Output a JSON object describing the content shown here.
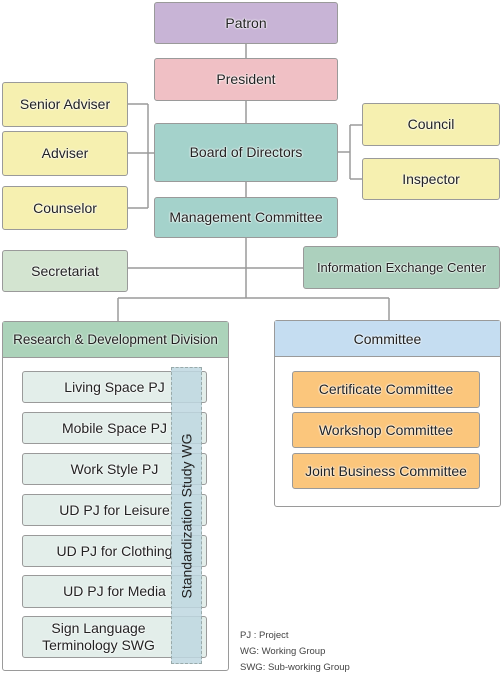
{
  "top": {
    "patron": "Patron",
    "president": "President",
    "board": "Board of Directors",
    "management": "Management Committee"
  },
  "left": [
    "Senior Adviser",
    "Adviser",
    "Counselor"
  ],
  "right": [
    "Council",
    "Inspector"
  ],
  "secretariat": "Secretariat",
  "info_center": "Information Exchange Center",
  "rd": {
    "title": "Research & Development Division",
    "items": [
      "Living Space PJ",
      "Mobile Space PJ",
      "Work Style PJ",
      "UD PJ for Leisure",
      "UD PJ for Clothing",
      "UD PJ for Media",
      "Sign Language Terminology SWG"
    ],
    "wg": "Standardization Study WG"
  },
  "committee": {
    "title": "Committee",
    "items": [
      "Certificate Committee",
      "Workshop Committee",
      "Joint Business Committee"
    ]
  },
  "legend": [
    "PJ : Project",
    "WG: Working Group",
    "SWG: Sub-working Group"
  ],
  "colors": {
    "patron": "#c8b4d6",
    "president": "#f0c0c5",
    "board": "#a4d2cb",
    "adviser": "#f6f0b0",
    "secretariat": "#d3e4d0",
    "info_center": "#acd0bd",
    "rd_header": "#acd3ba",
    "committee_header": "#c5ddf1",
    "committee_item": "#fbc67c",
    "line": "#9a9a9a"
  }
}
